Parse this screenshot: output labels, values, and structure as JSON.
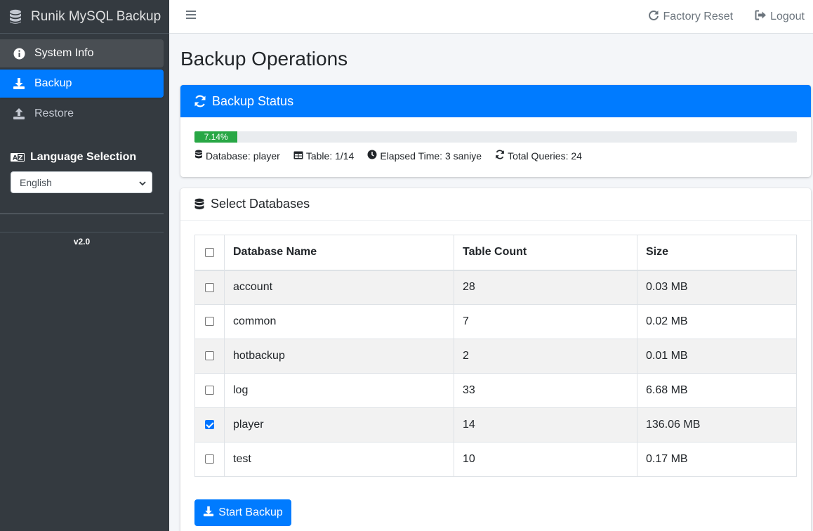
{
  "brand": {
    "title": "Runik MySQL Backup"
  },
  "sidebar": {
    "items": [
      {
        "label": "System Info",
        "icon": "info-circle-icon"
      },
      {
        "label": "Backup",
        "icon": "download-icon"
      },
      {
        "label": "Restore",
        "icon": "upload-icon"
      }
    ],
    "language": {
      "title": "Language Selection",
      "selected": "English"
    },
    "version": "v2.0"
  },
  "topbar": {
    "factory_reset": "Factory Reset",
    "logout": "Logout"
  },
  "page": {
    "title": "Backup Operations"
  },
  "status": {
    "header": "Backup Status",
    "progress_percent": 7.14,
    "progress_label": "7.14%",
    "database": "Database: player",
    "table": "Table: 1/14",
    "elapsed": "Elapsed Time: 3 saniye",
    "queries": "Total Queries: 24"
  },
  "databases": {
    "header": "Select Databases",
    "columns": [
      "Database Name",
      "Table Count",
      "Size"
    ],
    "rows": [
      {
        "name": "account",
        "count": "28",
        "size": "0.03 MB",
        "checked": false
      },
      {
        "name": "common",
        "count": "7",
        "size": "0.02 MB",
        "checked": false
      },
      {
        "name": "hotbackup",
        "count": "2",
        "size": "0.01 MB",
        "checked": false
      },
      {
        "name": "log",
        "count": "33",
        "size": "6.68 MB",
        "checked": false
      },
      {
        "name": "player",
        "count": "14",
        "size": "136.06 MB",
        "checked": true
      },
      {
        "name": "test",
        "count": "10",
        "size": "0.17 MB",
        "checked": false
      }
    ],
    "start_button": "Start Backup"
  },
  "colors": {
    "sidebar_bg": "#343a40",
    "primary": "#007bff",
    "success": "#28a745"
  }
}
